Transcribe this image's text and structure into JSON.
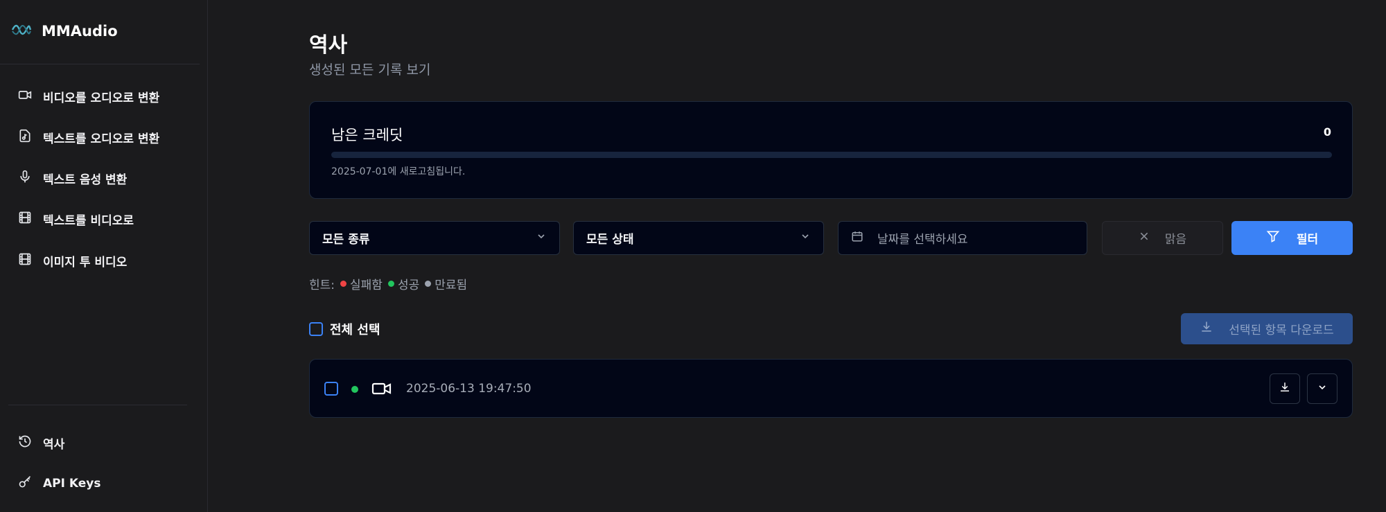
{
  "brand": {
    "name": "MMAudio"
  },
  "sidebar": {
    "items": [
      {
        "label": "비디오를 오디오로 변환",
        "icon": "video-camera-icon"
      },
      {
        "label": "텍스트를 오디오로 변환",
        "icon": "music-file-icon"
      },
      {
        "label": "텍스트 음성 변환",
        "icon": "microphone-icon"
      },
      {
        "label": "텍스트를 비디오로",
        "icon": "film-icon"
      },
      {
        "label": "이미지 투 비디오",
        "icon": "film-icon"
      }
    ],
    "bottom_items": [
      {
        "label": "역사",
        "icon": "history-icon"
      },
      {
        "label": "API Keys",
        "icon": "key-icon"
      }
    ]
  },
  "page": {
    "title": "역사",
    "subtitle": "생성된 모든 기록 보기"
  },
  "credits": {
    "label": "남은 크레딧",
    "value": "0",
    "progress_fraction": 0,
    "refresh_note": "2025-07-01에 새로고침됩니다."
  },
  "filters": {
    "type_select": "모든 종류",
    "status_select": "모든 상태",
    "date_placeholder": "날짜를 선택하세요",
    "clear_label": "맑음",
    "filter_label": "필터"
  },
  "hint": {
    "prefix": "힌트:",
    "items": [
      {
        "label": "실패함",
        "color": "#ef4444"
      },
      {
        "label": "성공",
        "color": "#22c55e"
      },
      {
        "label": "만료됨",
        "color": "#9ca3af"
      }
    ]
  },
  "list": {
    "select_all_label": "전체 선택",
    "download_selected_label": "선택된 항목 다운로드",
    "rows": [
      {
        "status_color": "#22c55e",
        "type_icon": "video-camera-icon",
        "date": "2025-06-13 19:47:50"
      }
    ]
  },
  "colors": {
    "accent": "#3b82f6",
    "background": "#1b1b1d",
    "card": "#020617"
  }
}
